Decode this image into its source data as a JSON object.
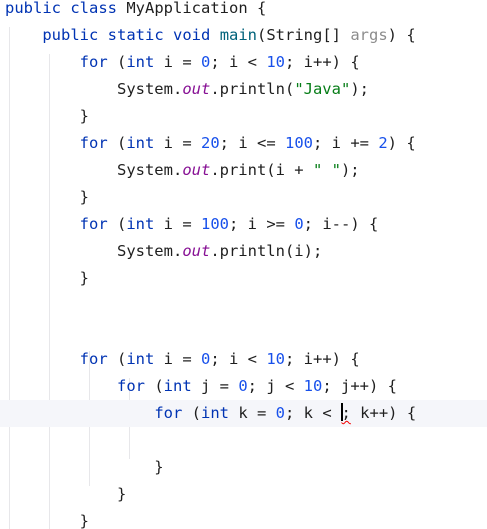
{
  "editor": {
    "language": "Java",
    "colors": {
      "keyword": "#0033b3",
      "number": "#1750eb",
      "string": "#067d17",
      "static_field": "#871094",
      "method_decl": "#00627a",
      "parameter_hint": "#8c8c8c",
      "text": "#1f1f1f",
      "current_line_bg": "#f5f6fa",
      "error_underline": "#f50000"
    },
    "caret_line": 15,
    "lines": [
      [
        {
          "t": "kw",
          "v": "public"
        },
        {
          "t": "",
          "v": " "
        },
        {
          "t": "kw",
          "v": "class"
        },
        {
          "t": "",
          "v": " MyApplication {"
        }
      ],
      [
        {
          "t": "",
          "v": "    "
        },
        {
          "t": "kw",
          "v": "public"
        },
        {
          "t": "",
          "v": " "
        },
        {
          "t": "kw",
          "v": "static"
        },
        {
          "t": "",
          "v": " "
        },
        {
          "t": "kw",
          "v": "void"
        },
        {
          "t": "",
          "v": " "
        },
        {
          "t": "mth",
          "v": "main"
        },
        {
          "t": "",
          "v": "(String[] "
        },
        {
          "t": "hint",
          "v": "args"
        },
        {
          "t": "",
          "v": ") {"
        }
      ],
      [
        {
          "t": "",
          "v": "        "
        },
        {
          "t": "kw",
          "v": "for"
        },
        {
          "t": "",
          "v": " ("
        },
        {
          "t": "kw",
          "v": "int"
        },
        {
          "t": "",
          "v": " i = "
        },
        {
          "t": "num",
          "v": "0"
        },
        {
          "t": "",
          "v": "; i < "
        },
        {
          "t": "num",
          "v": "10"
        },
        {
          "t": "",
          "v": "; i++) {"
        }
      ],
      [
        {
          "t": "",
          "v": "            System."
        },
        {
          "t": "fld",
          "v": "out"
        },
        {
          "t": "",
          "v": ".println("
        },
        {
          "t": "str",
          "v": "\"Java\""
        },
        {
          "t": "",
          "v": ");"
        }
      ],
      [
        {
          "t": "",
          "v": "        }"
        }
      ],
      [
        {
          "t": "",
          "v": "        "
        },
        {
          "t": "kw",
          "v": "for"
        },
        {
          "t": "",
          "v": " ("
        },
        {
          "t": "kw",
          "v": "int"
        },
        {
          "t": "",
          "v": " i = "
        },
        {
          "t": "num",
          "v": "20"
        },
        {
          "t": "",
          "v": "; i <= "
        },
        {
          "t": "num",
          "v": "100"
        },
        {
          "t": "",
          "v": "; i += "
        },
        {
          "t": "num",
          "v": "2"
        },
        {
          "t": "",
          "v": ") {"
        }
      ],
      [
        {
          "t": "",
          "v": "            System."
        },
        {
          "t": "fld",
          "v": "out"
        },
        {
          "t": "",
          "v": ".print(i + "
        },
        {
          "t": "str",
          "v": "\" \""
        },
        {
          "t": "",
          "v": ");"
        }
      ],
      [
        {
          "t": "",
          "v": "        }"
        }
      ],
      [
        {
          "t": "",
          "v": "        "
        },
        {
          "t": "kw",
          "v": "for"
        },
        {
          "t": "",
          "v": " ("
        },
        {
          "t": "kw",
          "v": "int"
        },
        {
          "t": "",
          "v": " i = "
        },
        {
          "t": "num",
          "v": "100"
        },
        {
          "t": "",
          "v": "; i >= "
        },
        {
          "t": "num",
          "v": "0"
        },
        {
          "t": "",
          "v": "; i--) {"
        }
      ],
      [
        {
          "t": "",
          "v": "            System."
        },
        {
          "t": "fld",
          "v": "out"
        },
        {
          "t": "",
          "v": ".println(i);"
        }
      ],
      [
        {
          "t": "",
          "v": "        }"
        }
      ],
      [],
      [],
      [
        {
          "t": "",
          "v": "        "
        },
        {
          "t": "kw",
          "v": "for"
        },
        {
          "t": "",
          "v": " ("
        },
        {
          "t": "kw",
          "v": "int"
        },
        {
          "t": "",
          "v": " i = "
        },
        {
          "t": "num",
          "v": "0"
        },
        {
          "t": "",
          "v": "; i < "
        },
        {
          "t": "num",
          "v": "10"
        },
        {
          "t": "",
          "v": "; i++) {"
        }
      ],
      [
        {
          "t": "",
          "v": "            "
        },
        {
          "t": "kw",
          "v": "for"
        },
        {
          "t": "",
          "v": " ("
        },
        {
          "t": "kw",
          "v": "int"
        },
        {
          "t": "",
          "v": " j = "
        },
        {
          "t": "num",
          "v": "0"
        },
        {
          "t": "",
          "v": "; j < "
        },
        {
          "t": "num",
          "v": "10"
        },
        {
          "t": "",
          "v": "; j++) {"
        }
      ],
      [
        {
          "t": "",
          "v": "                "
        },
        {
          "t": "kw",
          "v": "for"
        },
        {
          "t": "",
          "v": " ("
        },
        {
          "t": "kw",
          "v": "int"
        },
        {
          "t": "",
          "v": " k = "
        },
        {
          "t": "num",
          "v": "0"
        },
        {
          "t": "",
          "v": "; k < "
        },
        {
          "t": "caret",
          "v": ""
        },
        {
          "t": "err",
          "v": ";"
        },
        {
          "t": "",
          "v": " k++) {"
        }
      ],
      [],
      [
        {
          "t": "",
          "v": "                }"
        }
      ],
      [
        {
          "t": "",
          "v": "            }"
        }
      ],
      [
        {
          "t": "",
          "v": "        }"
        }
      ]
    ]
  }
}
